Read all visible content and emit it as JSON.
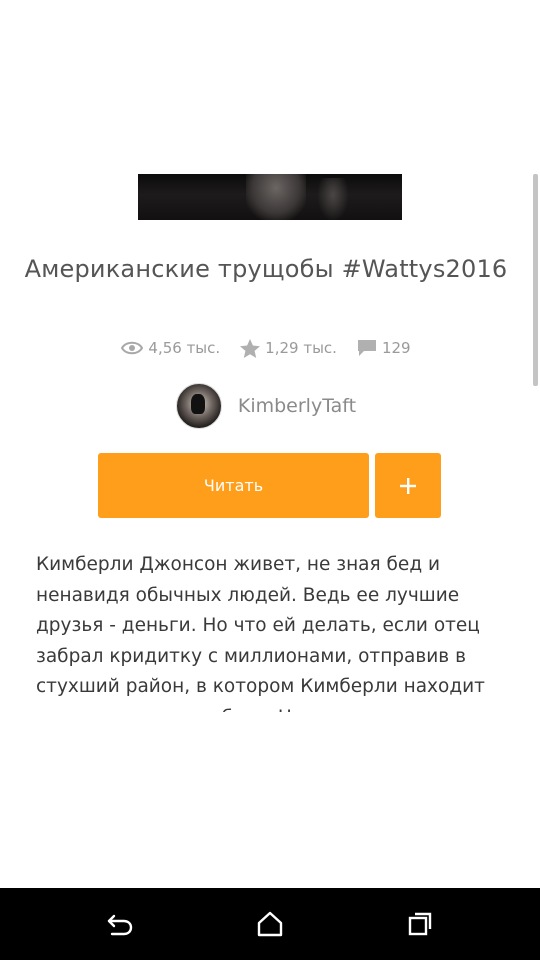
{
  "story": {
    "title": "Американские трущобы #Wattys2016",
    "stats": {
      "views": "4,56 тыс.",
      "votes": "1,29 тыс.",
      "comments": "129"
    },
    "author": "KimberlyTaft",
    "read_label": "Читать",
    "add_label": "+",
    "description_lines": [
      "Кимберли Джонсон живет, не зная бед и",
      "ненавидя обычных людей. Ведь ее лучшие",
      "друзья - деньги. Но что ей делать, если отец",
      "забрал кридитку с миллионами, отправив в",
      "стухший район, в котором Кимберли находит",
      "новых подруг и любовь.  Но главная цель"
    ]
  },
  "icons": {
    "views": "eye-icon",
    "votes": "star-icon",
    "comments": "comment-icon",
    "nav_back": "back-icon",
    "nav_home": "home-icon",
    "nav_recents": "recents-icon"
  },
  "colors": {
    "accent": "#ff9e1a",
    "navbar": "#000000"
  }
}
